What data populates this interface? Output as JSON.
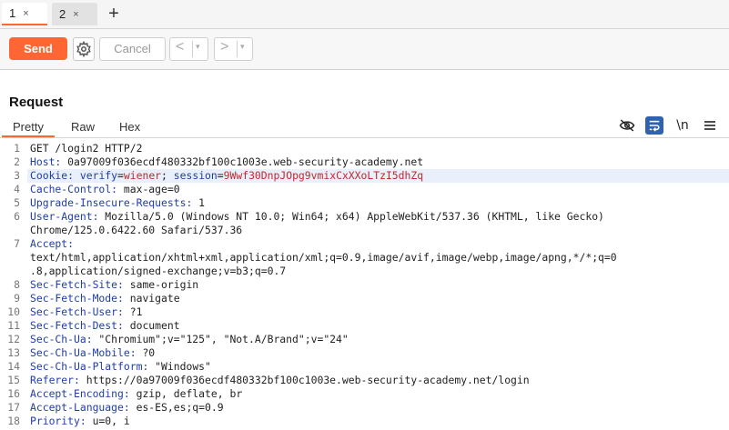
{
  "tabs": [
    {
      "label": "1",
      "close": "×"
    },
    {
      "label": "2",
      "close": "×"
    }
  ],
  "new_tab_label": "+",
  "toolbar": {
    "send_label": "Send",
    "cancel_label": "Cancel",
    "back_arrow": "<",
    "forward_arrow": ">",
    "dropdown_glyph": "▾"
  },
  "request": {
    "title": "Request",
    "view_tabs": [
      "Pretty",
      "Raw",
      "Hex"
    ],
    "newline_toggle": "\\n"
  },
  "code_lines": [
    {
      "n": "1",
      "text": "GET /login2 HTTP/2"
    },
    {
      "n": "2",
      "name": "Host:",
      "text": " 0a97009f036ecdf480332bf100c1003e.web-security-academy.net"
    },
    {
      "n": "3",
      "name": "Cookie:",
      "cookie": true,
      "c1n": "verify",
      "c1v": "wiener",
      "c2n": "session",
      "c2v": "9Wwf30DnpJOpg9vmixCxXXoLTzI5dhZq"
    },
    {
      "n": "4",
      "name": "Cache-Control:",
      "text": " max-age=0"
    },
    {
      "n": "5",
      "name": "Upgrade-Insecure-Requests:",
      "text": " 1"
    },
    {
      "n": "6",
      "name": "User-Agent:",
      "text": " Mozilla/5.0 (Windows NT 10.0; Win64; x64) AppleWebKit/537.36 (KHTML, like Gecko)"
    },
    {
      "n": "",
      "text": "Chrome/125.0.6422.60 Safari/537.36"
    },
    {
      "n": "7",
      "name": "Accept:",
      "text": ""
    },
    {
      "n": "",
      "text": "text/html,application/xhtml+xml,application/xml;q=0.9,image/avif,image/webp,image/apng,*/*;q=0"
    },
    {
      "n": "",
      "text": ".8,application/signed-exchange;v=b3;q=0.7"
    },
    {
      "n": "8",
      "name": "Sec-Fetch-Site:",
      "text": " same-origin"
    },
    {
      "n": "9",
      "name": "Sec-Fetch-Mode:",
      "text": " navigate"
    },
    {
      "n": "10",
      "name": "Sec-Fetch-User:",
      "text": " ?1"
    },
    {
      "n": "11",
      "name": "Sec-Fetch-Dest:",
      "text": " document"
    },
    {
      "n": "12",
      "name": "Sec-Ch-Ua:",
      "text": " \"Chromium\";v=\"125\", \"Not.A/Brand\";v=\"24\""
    },
    {
      "n": "13",
      "name": "Sec-Ch-Ua-Mobile:",
      "text": " ?0"
    },
    {
      "n": "14",
      "name": "Sec-Ch-Ua-Platform:",
      "text": " \"Windows\""
    },
    {
      "n": "15",
      "name": "Referer:",
      "text": " https://0a97009f036ecdf480332bf100c1003e.web-security-academy.net/login"
    },
    {
      "n": "16",
      "name": "Accept-Encoding:",
      "text": " gzip, deflate, br"
    },
    {
      "n": "17",
      "name": "Accept-Language:",
      "text": " es-ES,es;q=0.9"
    },
    {
      "n": "18",
      "name": "Priority:",
      "text": " u=0, i"
    }
  ],
  "colors": {
    "accent": "#ff6633",
    "header_name": "#1f3ea8",
    "cookie_value": "#c62828"
  }
}
